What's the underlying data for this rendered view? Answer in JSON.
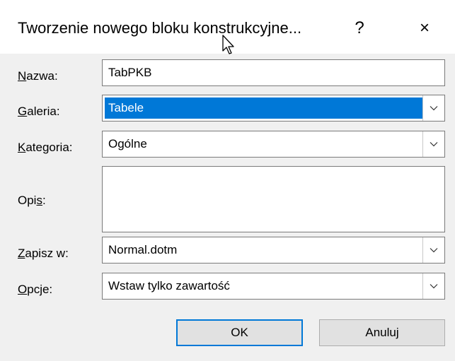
{
  "dialog": {
    "title": "Tworzenie nowego bloku konstrukcyjne...",
    "help_label": "?",
    "close_label": "×"
  },
  "form": {
    "name": {
      "label_underlined": "N",
      "label_rest": "azwa:",
      "value": "TabPKB"
    },
    "gallery": {
      "label_underlined": "G",
      "label_rest": "aleria:",
      "value": "Tabele"
    },
    "category": {
      "label_underlined": "K",
      "label_rest": "ategoria:",
      "value": "Ogólne"
    },
    "description": {
      "label_before": "Opi",
      "label_underlined": "s",
      "label_after": ":",
      "value": ""
    },
    "save_in": {
      "label_underlined": "Z",
      "label_rest": "apisz w:",
      "value": "Normal.dotm"
    },
    "options": {
      "label_underlined": "O",
      "label_rest": "pcje:",
      "value": "Wstaw tylko zawartość"
    }
  },
  "buttons": {
    "ok_label": "OK",
    "cancel_label": "Anuluj"
  },
  "colors": {
    "selection": "#0078d7",
    "default_button_border": "#0078d7",
    "field_border": "#7a7a7a"
  }
}
